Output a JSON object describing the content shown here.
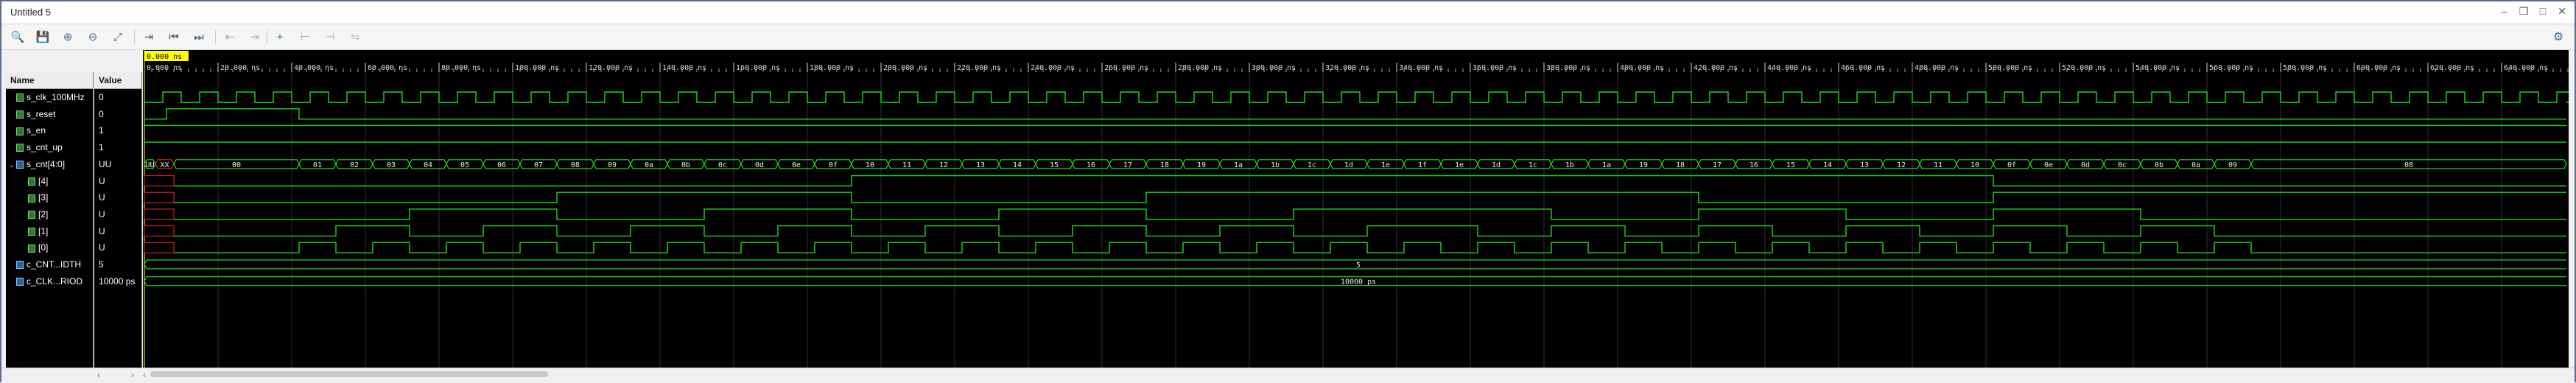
{
  "window": {
    "title": "Untitled 5"
  },
  "toolbar": {
    "buttons": [
      {
        "name": "search-icon",
        "glyph": "🔍"
      },
      {
        "name": "save-icon",
        "glyph": "💾"
      },
      {
        "name": "zoom-in-icon",
        "glyph": "⊕"
      },
      {
        "name": "zoom-out-icon",
        "glyph": "⊖"
      },
      {
        "name": "zoom-fit-icon",
        "glyph": "⤢"
      },
      {
        "name": "go-to-cursor-icon",
        "glyph": "⇥"
      },
      {
        "name": "go-to-time-zero-icon",
        "glyph": "⏮"
      },
      {
        "name": "go-to-last-time-icon",
        "glyph": "⏭"
      },
      {
        "name": "previous-transition-icon",
        "glyph": "⇤"
      },
      {
        "name": "next-transition-icon",
        "glyph": "⇥"
      },
      {
        "name": "add-marker-icon",
        "glyph": "+"
      },
      {
        "name": "previous-marker-icon",
        "glyph": "⊢"
      },
      {
        "name": "next-marker-icon",
        "glyph": "⊣"
      },
      {
        "name": "swap-cursors-icon",
        "glyph": "⇋"
      }
    ]
  },
  "panel": {
    "name_header": "Name",
    "value_header": "Value"
  },
  "signals": [
    {
      "name": "s_clk_100MHz",
      "value": "0",
      "type": "bit",
      "indent": 0
    },
    {
      "name": "s_reset",
      "value": "0",
      "type": "bit",
      "indent": 0
    },
    {
      "name": "s_en",
      "value": "1",
      "type": "bit",
      "indent": 0
    },
    {
      "name": "s_cnt_up",
      "value": "1",
      "type": "bit",
      "indent": 0
    },
    {
      "name": "s_cnt[4:0]",
      "value": "UU",
      "type": "bus",
      "indent": 0,
      "expanded": true
    },
    {
      "name": "[4]",
      "value": "U",
      "type": "bit",
      "indent": 1
    },
    {
      "name": "[3]",
      "value": "U",
      "type": "bit",
      "indent": 1
    },
    {
      "name": "[2]",
      "value": "U",
      "type": "bit",
      "indent": 1
    },
    {
      "name": "[1]",
      "value": "U",
      "type": "bit",
      "indent": 1
    },
    {
      "name": "[0]",
      "value": "U",
      "type": "bit",
      "indent": 1
    },
    {
      "name": "c_CNT...IDTH",
      "value": "5",
      "type": "bus",
      "indent": 0
    },
    {
      "name": "c_CLK...RIOD",
      "value": "10000 ps",
      "type": "bus",
      "indent": 0
    }
  ],
  "cursor": {
    "label": "0.000 ns"
  },
  "timeline": {
    "ticks": [
      "0.000 ns",
      "20.000 ns",
      "40.000 ns",
      "60.000 ns",
      "80.000 ns",
      "100.000 ns",
      "120.000 ns",
      "140.000 ns",
      "160.000 ns",
      "180.000 ns",
      "200.000 ns",
      "220.000 ns",
      "240.000 ns",
      "260.000 ns",
      "280.000 ns",
      "300.000 ns",
      "320.000 ns",
      "340.000 ns",
      "360.000 ns",
      "380.000 ns",
      "400.000 ns",
      "420.000 ns",
      "440.000 ns",
      "460.000 ns",
      "480.000 ns",
      "500.000 ns",
      "520.000 ns",
      "540.000 ns",
      "560.000 ns",
      "580.000 ns",
      "600.000 ns",
      "620.000 ns",
      "640.000 ns"
    ]
  },
  "bus_values": {
    "s_cnt": [
      "UU",
      "XX",
      "00",
      "01",
      "02",
      "03",
      "04",
      "05",
      "06",
      "07",
      "08",
      "09",
      "0a",
      "0b",
      "0c",
      "0d",
      "0e",
      "0f",
      "10",
      "11",
      "12",
      "13",
      "14",
      "15",
      "16",
      "17",
      "18",
      "19",
      "1a",
      "1b",
      "1c",
      "1d",
      "1e",
      "1f",
      "1e",
      "1d",
      "1c",
      "1b",
      "1a",
      "19",
      "18",
      "17",
      "16",
      "15",
      "14",
      "13",
      "12",
      "11",
      "10",
      "0f",
      "0e",
      "0d",
      "0c",
      "0b",
      "0a",
      "09",
      "08"
    ],
    "c_cnt_width": "5",
    "c_clk_period": "10000 ps"
  },
  "colors": {
    "wave": "#1fd81f",
    "bus_fill": "#0a3a0a",
    "x_red": "#cc2222",
    "grid": "#2f2f2f",
    "cursor": "#ffff00"
  }
}
